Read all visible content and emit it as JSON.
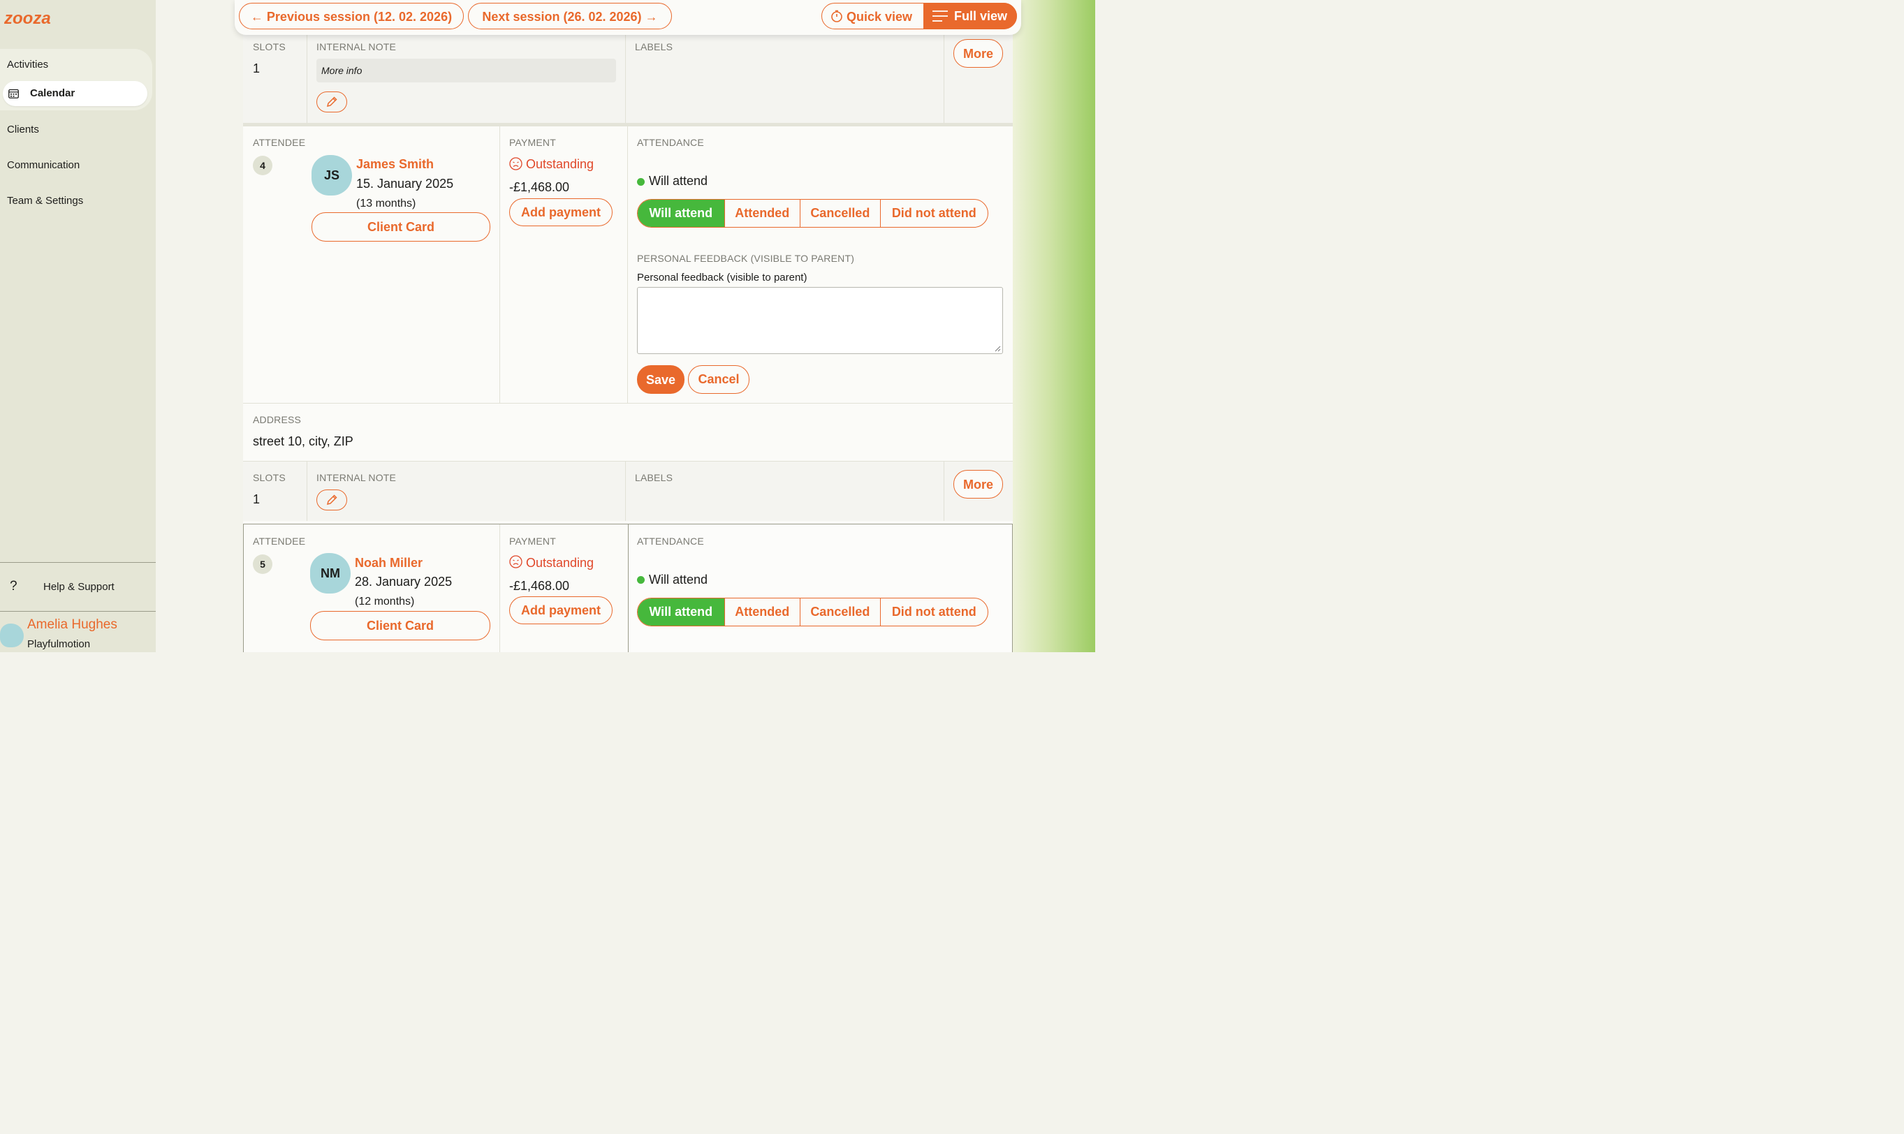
{
  "sidebar": {
    "logo_text": "zooza",
    "items": [
      {
        "label": "Activities"
      },
      {
        "label": "Calendar"
      },
      {
        "label": "Clients"
      },
      {
        "label": "Communication"
      },
      {
        "label": "Team & Settings"
      }
    ],
    "help": {
      "icon": "?",
      "label": "Help & Support"
    },
    "user": {
      "name": "Amelia Hughes",
      "org": "Playfulmotion"
    }
  },
  "toolbar": {
    "prev_label": "Previous session (12. 02. 2026)",
    "next_label": "Next session (26. 02. 2026)",
    "quick_view_label": "Quick view",
    "full_view_label": "Full view"
  },
  "colors": {
    "accent": "#e9692c",
    "success": "#46b83c",
    "danger": "#e0482a"
  },
  "block1": {
    "slots_label": "SLOTS",
    "slots_value": "1",
    "note_label": "INTERNAL NOTE",
    "note_value": "More info",
    "labels_label": "LABELS",
    "more_label": "More"
  },
  "attendees": [
    {
      "attendee_label": "ATTENDEE",
      "number": "4",
      "initials": "JS",
      "name": "James Smith",
      "date": "15. January 2025",
      "age": "(13 months)",
      "client_card": "Client Card",
      "payment_label": "PAYMENT",
      "payment_status": "Outstanding",
      "amount": "-£1,468.00",
      "add_payment": "Add payment",
      "attendance_label": "ATTENDANCE",
      "attendance_status": "Will attend",
      "options": [
        "Will attend",
        "Attended",
        "Cancelled",
        "Did not attend"
      ],
      "feedback_label": "PERSONAL FEEDBACK (VISIBLE TO PARENT)",
      "feedback_title": "Personal feedback (visible to parent)",
      "save": "Save",
      "cancel": "Cancel",
      "address_label": "ADDRESS",
      "address": "street 10, city, ZIP",
      "slots_label": "SLOTS",
      "slots_value": "1",
      "note_label": "INTERNAL NOTE",
      "labels_label": "LABELS",
      "more_label": "More"
    },
    {
      "attendee_label": "ATTENDEE",
      "number": "5",
      "initials": "NM",
      "name": "Noah Miller",
      "date": "28. January 2025",
      "age": "(12 months)",
      "client_card": "Client Card",
      "payment_label": "PAYMENT",
      "payment_status": "Outstanding",
      "amount": "-£1,468.00",
      "add_payment": "Add payment",
      "attendance_label": "ATTENDANCE",
      "attendance_status": "Will attend",
      "options": [
        "Will attend",
        "Attended",
        "Cancelled",
        "Did not attend"
      ]
    }
  ]
}
